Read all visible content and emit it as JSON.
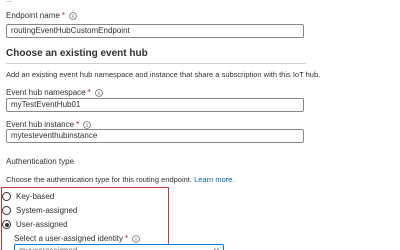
{
  "top_text_cut": "...",
  "endpoint_name": {
    "label": "Endpoint name",
    "required_mark": "*",
    "value": "routingEventHubCustomEndpoint"
  },
  "event_hub_section": {
    "title": "Choose an existing event hub",
    "description": "Add an existing event hub namespace and instance that share a subscription with this IoT hub."
  },
  "namespace": {
    "label": "Event hub namespace",
    "required_mark": "*",
    "value": "myTestEventHub01"
  },
  "instance": {
    "label": "Event hub instance",
    "required_mark": "*",
    "value": "mytesteventhubinstance"
  },
  "auth": {
    "title": "Authentication type",
    "description": "Choose the authentication type for this routing endpoint.",
    "learn_more": "Learn more.",
    "options": [
      {
        "label": "Key-based",
        "checked": false
      },
      {
        "label": "System-assigned",
        "checked": false
      },
      {
        "label": "User-assigned",
        "checked": true
      }
    ],
    "identity_label": "Select a user-assigned identity",
    "required_mark": "*",
    "identity_value": "myuserassigned"
  },
  "colors": {
    "accent": "#0078d4",
    "highlight_border": "#d13438",
    "required": "#a4262c",
    "link": "#0067b8"
  },
  "icons": [
    "info-icon",
    "chevron-down-icon"
  ]
}
